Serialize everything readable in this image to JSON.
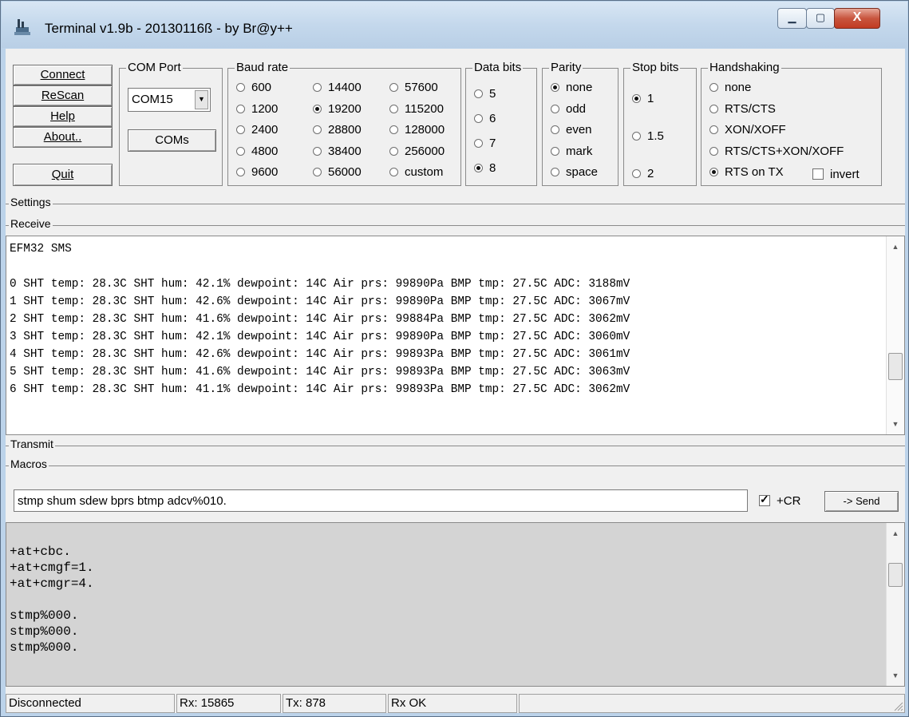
{
  "window": {
    "title": "Terminal v1.9b - 20130116ß - by Br@y++",
    "controls": {
      "minimize": "▁",
      "maximize": "▢",
      "close": "X"
    }
  },
  "buttons": {
    "connect": "Connect",
    "rescan": "ReScan",
    "help": "Help",
    "about": "About..",
    "quit": "Quit",
    "coms": "COMs"
  },
  "com_port": {
    "label": "COM Port",
    "selected": "COM15"
  },
  "baud_rate": {
    "label": "Baud rate",
    "options": [
      {
        "label": "600",
        "checked": false
      },
      {
        "label": "1200",
        "checked": false
      },
      {
        "label": "2400",
        "checked": false
      },
      {
        "label": "4800",
        "checked": false
      },
      {
        "label": "9600",
        "checked": false
      },
      {
        "label": "14400",
        "checked": false
      },
      {
        "label": "19200",
        "checked": true
      },
      {
        "label": "28800",
        "checked": false
      },
      {
        "label": "38400",
        "checked": false
      },
      {
        "label": "56000",
        "checked": false
      },
      {
        "label": "57600",
        "checked": false
      },
      {
        "label": "115200",
        "checked": false
      },
      {
        "label": "128000",
        "checked": false
      },
      {
        "label": "256000",
        "checked": false
      },
      {
        "label": "custom",
        "checked": false
      }
    ]
  },
  "data_bits": {
    "label": "Data bits",
    "options": [
      {
        "label": "5",
        "checked": false
      },
      {
        "label": "6",
        "checked": false
      },
      {
        "label": "7",
        "checked": false
      },
      {
        "label": "8",
        "checked": true
      }
    ]
  },
  "parity": {
    "label": "Parity",
    "options": [
      {
        "label": "none",
        "checked": true
      },
      {
        "label": "odd",
        "checked": false
      },
      {
        "label": "even",
        "checked": false
      },
      {
        "label": "mark",
        "checked": false
      },
      {
        "label": "space",
        "checked": false
      }
    ]
  },
  "stop_bits": {
    "label": "Stop bits",
    "options": [
      {
        "label": "1",
        "checked": true
      },
      {
        "label": "1.5",
        "checked": false
      },
      {
        "label": "2",
        "checked": false
      }
    ]
  },
  "handshaking": {
    "label": "Handshaking",
    "options": [
      {
        "label": "none",
        "checked": false
      },
      {
        "label": "RTS/CTS",
        "checked": false
      },
      {
        "label": "XON/XOFF",
        "checked": false
      },
      {
        "label": "RTS/CTS+XON/XOFF",
        "checked": false
      },
      {
        "label": "RTS on TX",
        "checked": true
      }
    ],
    "invert_label": "invert",
    "invert_checked": false
  },
  "sections": {
    "settings": "Settings",
    "receive": "Receive",
    "transmit": "Transmit",
    "macros": "Macros"
  },
  "receive": {
    "lines": [
      "EFM32 SMS",
      "",
      "0 SHT temp: 28.3C SHT hum: 42.1% dewpoint: 14C Air prs: 99890Pa BMP tmp: 27.5C ADC: 3188mV",
      "1 SHT temp: 28.3C SHT hum: 42.6% dewpoint: 14C Air prs: 99890Pa BMP tmp: 27.5C ADC: 3067mV",
      "2 SHT temp: 28.3C SHT hum: 41.6% dewpoint: 14C Air prs: 99884Pa BMP tmp: 27.5C ADC: 3062mV",
      "3 SHT temp: 28.3C SHT hum: 42.1% dewpoint: 14C Air prs: 99890Pa BMP tmp: 27.5C ADC: 3060mV",
      "4 SHT temp: 28.3C SHT hum: 42.6% dewpoint: 14C Air prs: 99893Pa BMP tmp: 27.5C ADC: 3061mV",
      "5 SHT temp: 28.3C SHT hum: 41.6% dewpoint: 14C Air prs: 99893Pa BMP tmp: 27.5C ADC: 3063mV",
      "6 SHT temp: 28.3C SHT hum: 41.1% dewpoint: 14C Air prs: 99893Pa BMP tmp: 27.5C ADC: 3062mV"
    ]
  },
  "command": {
    "value": "stmp shum sdew bprs btmp adcv%010.",
    "cr_label": "+CR",
    "cr_checked": true,
    "send_label": "-> Send"
  },
  "transmit": {
    "lines": [
      "",
      "+at+cbc.",
      "+at+cmgf=1.",
      "+at+cmgr=4.",
      "",
      "stmp%000.",
      "stmp%000.",
      "stmp%000."
    ]
  },
  "status": {
    "connection": "Disconnected",
    "rx": "Rx: 15865",
    "tx": "Tx: 878",
    "rx_state": "Rx OK"
  }
}
